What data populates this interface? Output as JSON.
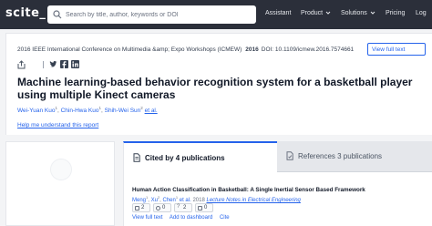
{
  "nav": {
    "logo": "scite_",
    "search_placeholder": "Search by title, author, keywords or DOI",
    "links": [
      "Assistant",
      "Product",
      "Solutions",
      "Pricing",
      "Log"
    ]
  },
  "paper": {
    "venue": "2016 IEEE International Conference on Multimedia &amp; Expo Workshops (ICMEW)",
    "year": "2016",
    "doi": "DOI: 10.1109/icmew.2016.7574661",
    "full_text_button": "View full text",
    "title": "Machine learning-based behavior recognition system for a basketball player using multiple Kinect cameras",
    "authors": [
      {
        "name": "Wei-Yuan Kuo",
        "sup": "1"
      },
      {
        "name": "Chin-Hwa Kuo",
        "sup": "1"
      },
      {
        "name": "Shih-Wei Sun",
        "sup": "2"
      }
    ],
    "et_al": "et al.",
    "help_link": "Help me understand this report"
  },
  "tabs": {
    "cited": "Cited by 4 publications",
    "references": "References 3 publications"
  },
  "citation": {
    "title": "Human Action Classification in Basketball: A Single Inertial Sensor Based Framework",
    "authors": "Meng",
    "authors2": "Xu",
    "authors3": "Chen",
    "et_al": "et al.",
    "year": "2018",
    "journal": "Lecture Notes in Electrical Engineering",
    "badges": [
      "2",
      "0",
      "2",
      "0"
    ],
    "actions": [
      "View full text",
      "Add to dashboard",
      "Cite"
    ]
  },
  "colors": {
    "nav_bg": "#2b2f3a",
    "accent": "#2563eb"
  }
}
